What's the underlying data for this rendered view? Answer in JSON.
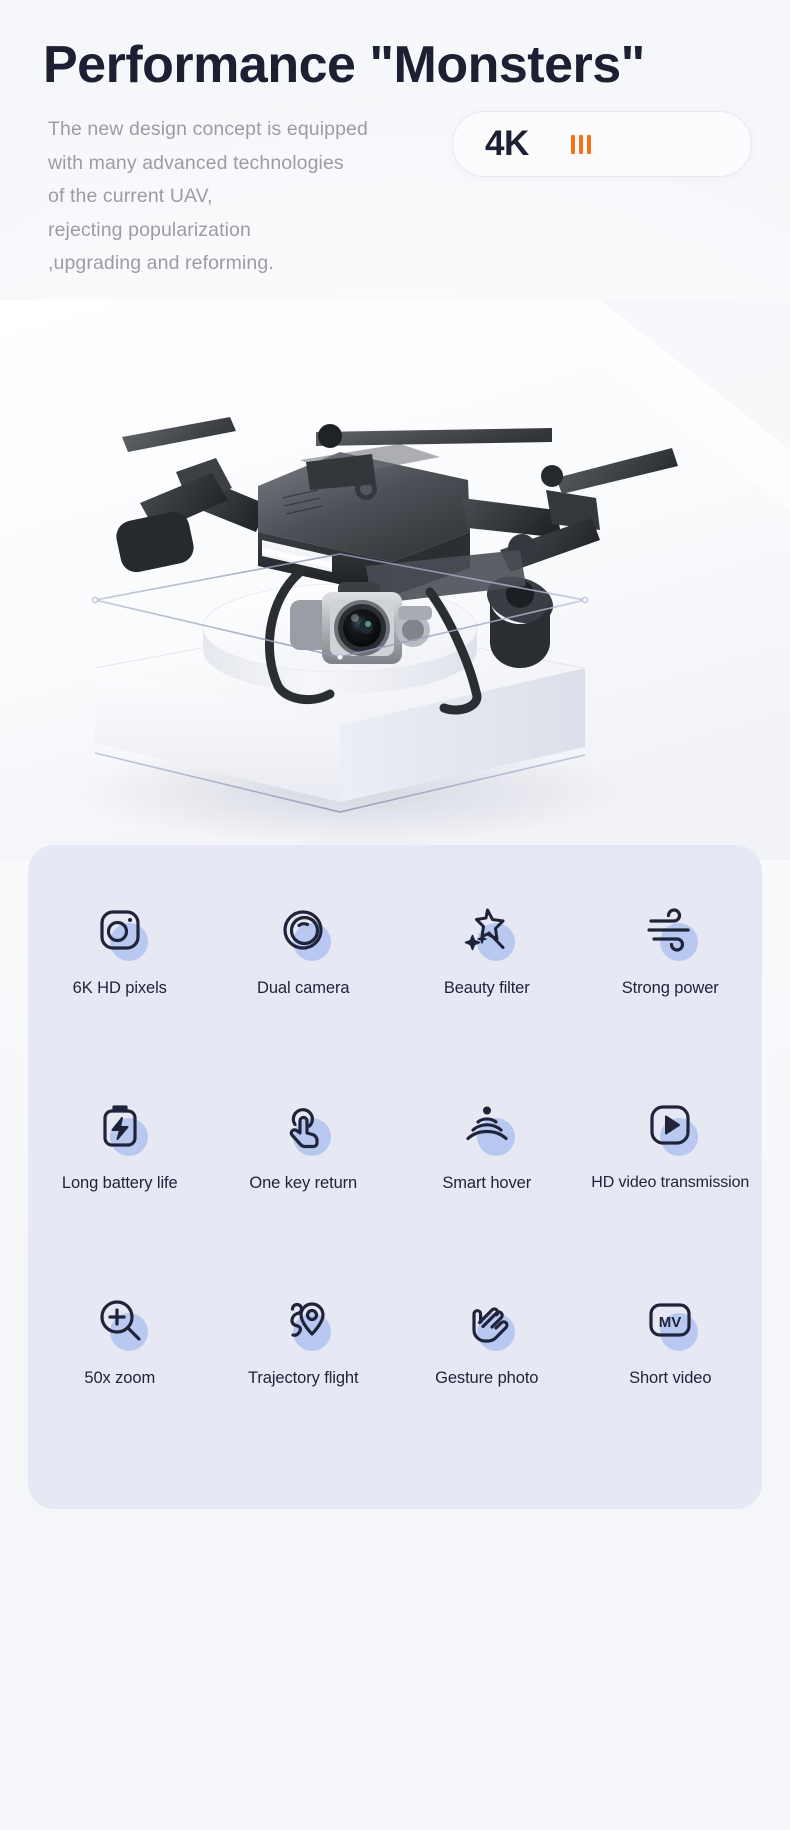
{
  "header": {
    "title": "Performance \"Monsters\"",
    "subtitle_lines": [
      "The new design concept is equipped",
      "with many advanced technologies",
      "of the current UAV,",
      "rejecting popularization",
      ",upgrading and reforming."
    ],
    "badge": {
      "value": "4K",
      "indicator_bars": 3,
      "accent_color": "#f97316"
    }
  },
  "hero": {
    "alt": "black-quadcopter-drone-with-gimbal-camera-on-white-podium",
    "product": "UAV drone with 4K gimbal camera",
    "display": {
      "podium_shape": "cylinder",
      "case_shape": "glass-cube"
    }
  },
  "features": {
    "background_color": "#e6e9f3",
    "accent_blob_color": "#b9c8f0",
    "icon_color": "#20243a",
    "rows": [
      [
        {
          "icon": "camera-icon",
          "label": "6K HD pixels"
        },
        {
          "icon": "lens-icon",
          "label": "Dual camera"
        },
        {
          "icon": "magic-wand-icon",
          "label": "Beauty filter"
        },
        {
          "icon": "wind-icon",
          "label": "Strong power"
        }
      ],
      [
        {
          "icon": "battery-bolt-icon",
          "label": "Long battery life"
        },
        {
          "icon": "hand-tap-icon",
          "label": "One key return"
        },
        {
          "icon": "signal-waves-icon",
          "label": "Smart hover"
        },
        {
          "icon": "play-square-icon",
          "label": "HD video transmission"
        }
      ],
      [
        {
          "icon": "zoom-in-icon",
          "label": "50x zoom"
        },
        {
          "icon": "route-pin-icon",
          "label": "Trajectory flight"
        },
        {
          "icon": "hand-wave-icon",
          "label": "Gesture photo"
        },
        {
          "icon": "mv-square-icon",
          "label": "Short video"
        }
      ]
    ]
  }
}
